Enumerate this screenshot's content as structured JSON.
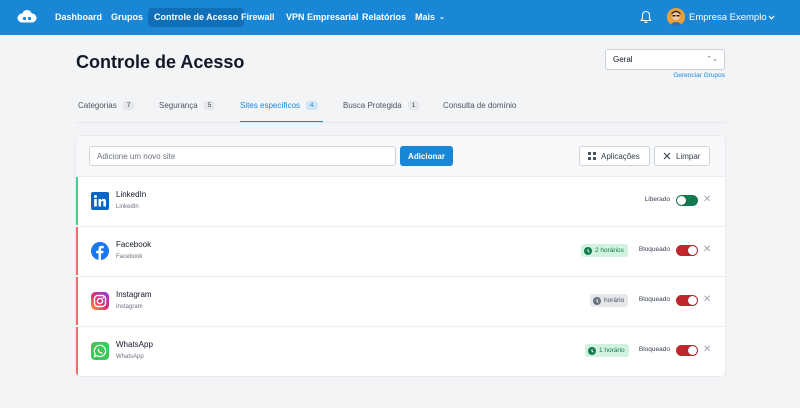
{
  "nav": {
    "items": [
      {
        "label": "Dashboard",
        "active": false
      },
      {
        "label": "Grupos",
        "active": false
      },
      {
        "label": "Controle de Acesso",
        "active": true
      },
      {
        "label": "Firewall",
        "active": false
      },
      {
        "label": "VPN Empresarial",
        "active": false
      },
      {
        "label": "Relatórios",
        "active": false
      },
      {
        "label": "Mais",
        "active": false
      }
    ],
    "company": "Empresa Exemplo"
  },
  "page": {
    "title": "Controle de Acesso",
    "group_select": "Geral",
    "manage_groups": "Gerenciar Grupos"
  },
  "tabs": [
    {
      "label": "Categorias",
      "count": "7"
    },
    {
      "label": "Segurança",
      "count": "5"
    },
    {
      "label": "Sites específicos",
      "count": "4"
    },
    {
      "label": "Busca Protegida",
      "count": "1"
    },
    {
      "label": "Consulta de domínio",
      "count": ""
    }
  ],
  "toolbar": {
    "input_placeholder": "Adicione um novo site",
    "add_label": "Adicionar",
    "apps_label": "Aplicações",
    "clear_label": "Limpar"
  },
  "sites": [
    {
      "name": "LinkedIn",
      "sub": "LinkedIn",
      "status": "Liberado",
      "timer": "",
      "icon": "linkedin-icon"
    },
    {
      "name": "Facebook",
      "sub": "Facebook",
      "status": "Bloqueado",
      "timer": "2 horários",
      "icon": "facebook-icon"
    },
    {
      "name": "Instagram",
      "sub": "Instagram",
      "status": "Bloqueado",
      "timer": "horário",
      "icon": "instagram-icon"
    },
    {
      "name": "WhatsApp",
      "sub": "WhatsApp",
      "status": "Bloqueado",
      "timer": "1 horário",
      "icon": "whatsapp-icon"
    }
  ],
  "colors": {
    "primary": "#1a87d6",
    "allowed": "#137a4f",
    "blocked": "#c0272d",
    "timer_green_bg": "#d1f2df",
    "timer_gray_bg": "#e5e7eb"
  }
}
